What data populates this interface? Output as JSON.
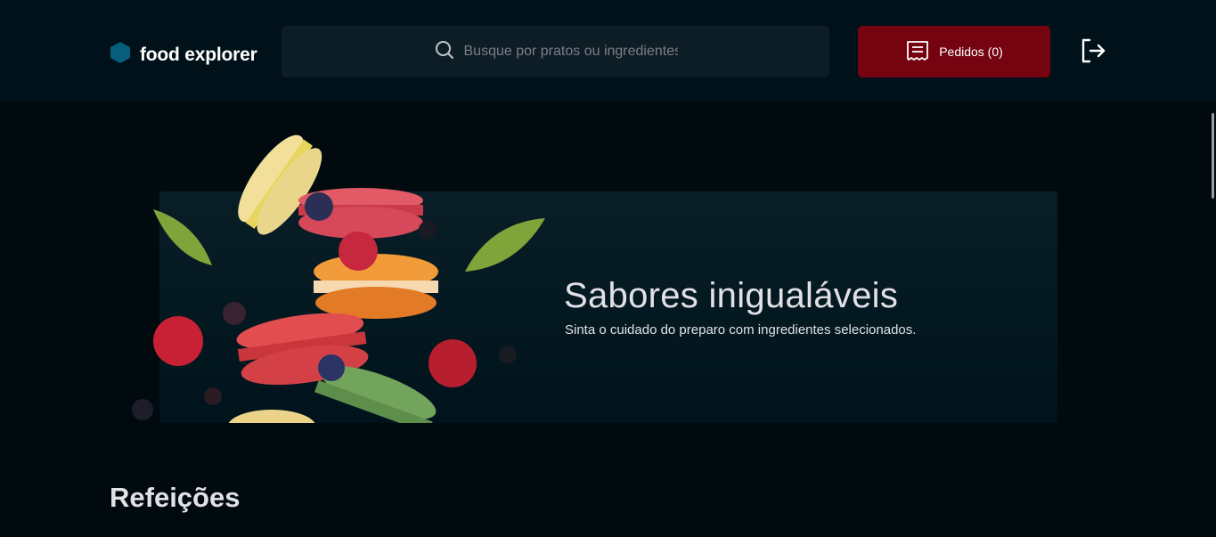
{
  "brand": {
    "name": "food explorer",
    "icon": "hexagon-logo-icon",
    "color": "#065E7C"
  },
  "search": {
    "placeholder": "Busque por pratos ou ingredientes",
    "value": "",
    "icon": "search-icon"
  },
  "orders_button": {
    "label": "Pedidos (0)",
    "icon": "receipt-icon",
    "color": "#750310"
  },
  "logout": {
    "icon": "sign-out-icon"
  },
  "banner": {
    "title": "Sabores inigualáveis",
    "subtitle": "Sinta o cuidado do preparo com ingredientes selecionados."
  },
  "sections": [
    {
      "title": "Refeições"
    }
  ],
  "colors": {
    "background": "#000A0F",
    "header": "#00111A",
    "input": "#0D1D25",
    "text": "#E1E1E6"
  }
}
